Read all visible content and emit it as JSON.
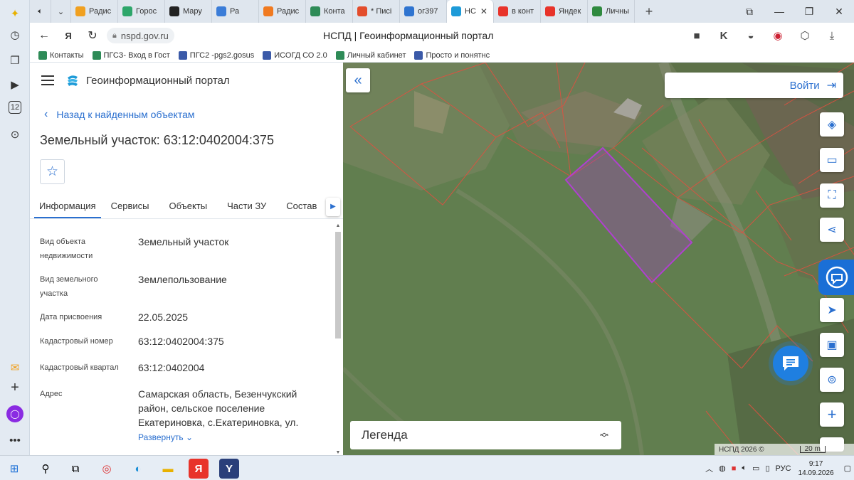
{
  "browser": {
    "tabs": [
      {
        "label": "Радис",
        "color": "#f0a020"
      },
      {
        "label": "Горос",
        "color": "#2da66a"
      },
      {
        "label": "Мару",
        "color": "#222222"
      },
      {
        "label": "Ра",
        "color": "#3b7dd8"
      },
      {
        "label": "Радис",
        "color": "#f07a20"
      },
      {
        "label": "Конта",
        "color": "#2e8b57"
      },
      {
        "label": "* Писі",
        "color": "#e34d2c"
      },
      {
        "label": "ог397",
        "color": "#2f74d0"
      },
      {
        "label": "НС",
        "color": "#1e9bd8",
        "active": true
      },
      {
        "label": "в конт",
        "color": "#e8332a"
      },
      {
        "label": "Яндек",
        "color": "#e8332a"
      },
      {
        "label": "Личны",
        "color": "#2f8a3f"
      }
    ],
    "url": "nspd.gov.ru",
    "page_title": "НСПД | Геоинформационный портал",
    "bookmarks": [
      "Контакты",
      "ПГСЗ- Вход в Гост",
      "ПГС2 -pgs2.gosus",
      "ИСОГД СО 2.0",
      "Личный кабинет",
      "Просто и понятнс"
    ]
  },
  "sidebar_icons": [
    "sparkle-icon",
    "clock-icon",
    "collections-icon",
    "video-icon",
    "calendar-icon",
    "screenshot-icon",
    "mail-icon",
    "plus-icon",
    "alice-icon",
    "more-icon"
  ],
  "sidebar_calendar_day": "12",
  "panel": {
    "app_title": "Геоинформационный портал",
    "back_label": "Назад к найденным объектам",
    "object_title": "Земельный участок: 63:12:0402004:375",
    "tabs": [
      "Информация",
      "Сервисы",
      "Объекты",
      "Части ЗУ",
      "Состав"
    ],
    "fields": [
      {
        "label": "Вид объекта недвижимости",
        "value": "Земельный участок"
      },
      {
        "label": "Вид земельного участка",
        "value": "Землепользование"
      },
      {
        "label": "Дата присвоения",
        "value": "22.05.2025"
      },
      {
        "label": "Кадастровый номер",
        "value": "63:12:0402004:375"
      },
      {
        "label": "Кадастровый квартал",
        "value": "63:12:0402004"
      },
      {
        "label": "Адрес",
        "value": "Самарская область, Безенчукский район, сельское поселение Екатериновка, с.Екатериновка, ул."
      }
    ],
    "expand_label": "Развернуть"
  },
  "map": {
    "login_label": "Войти",
    "legend_label": "Легенда",
    "attribution": "НСПД 2026 ©",
    "scale_label": "20 m",
    "controls": [
      "layers-icon",
      "ruler-icon",
      "select-area-icon",
      "share-icon",
      "locate-icon",
      "frame-icon",
      "geo-search-icon",
      "zoom-in-icon"
    ],
    "highlight_color": "#a040c0",
    "parcel_border_color": "#e05040"
  },
  "taskbar": {
    "apps": [
      "windows-start-icon",
      "search-icon",
      "task-view-icon",
      "chrome-icon",
      "edge-icon",
      "explorer-icon",
      "yandex-icon",
      "yandex-browser-icon"
    ],
    "language": "РУС",
    "time": "9:17",
    "date": "14.09.2026"
  }
}
